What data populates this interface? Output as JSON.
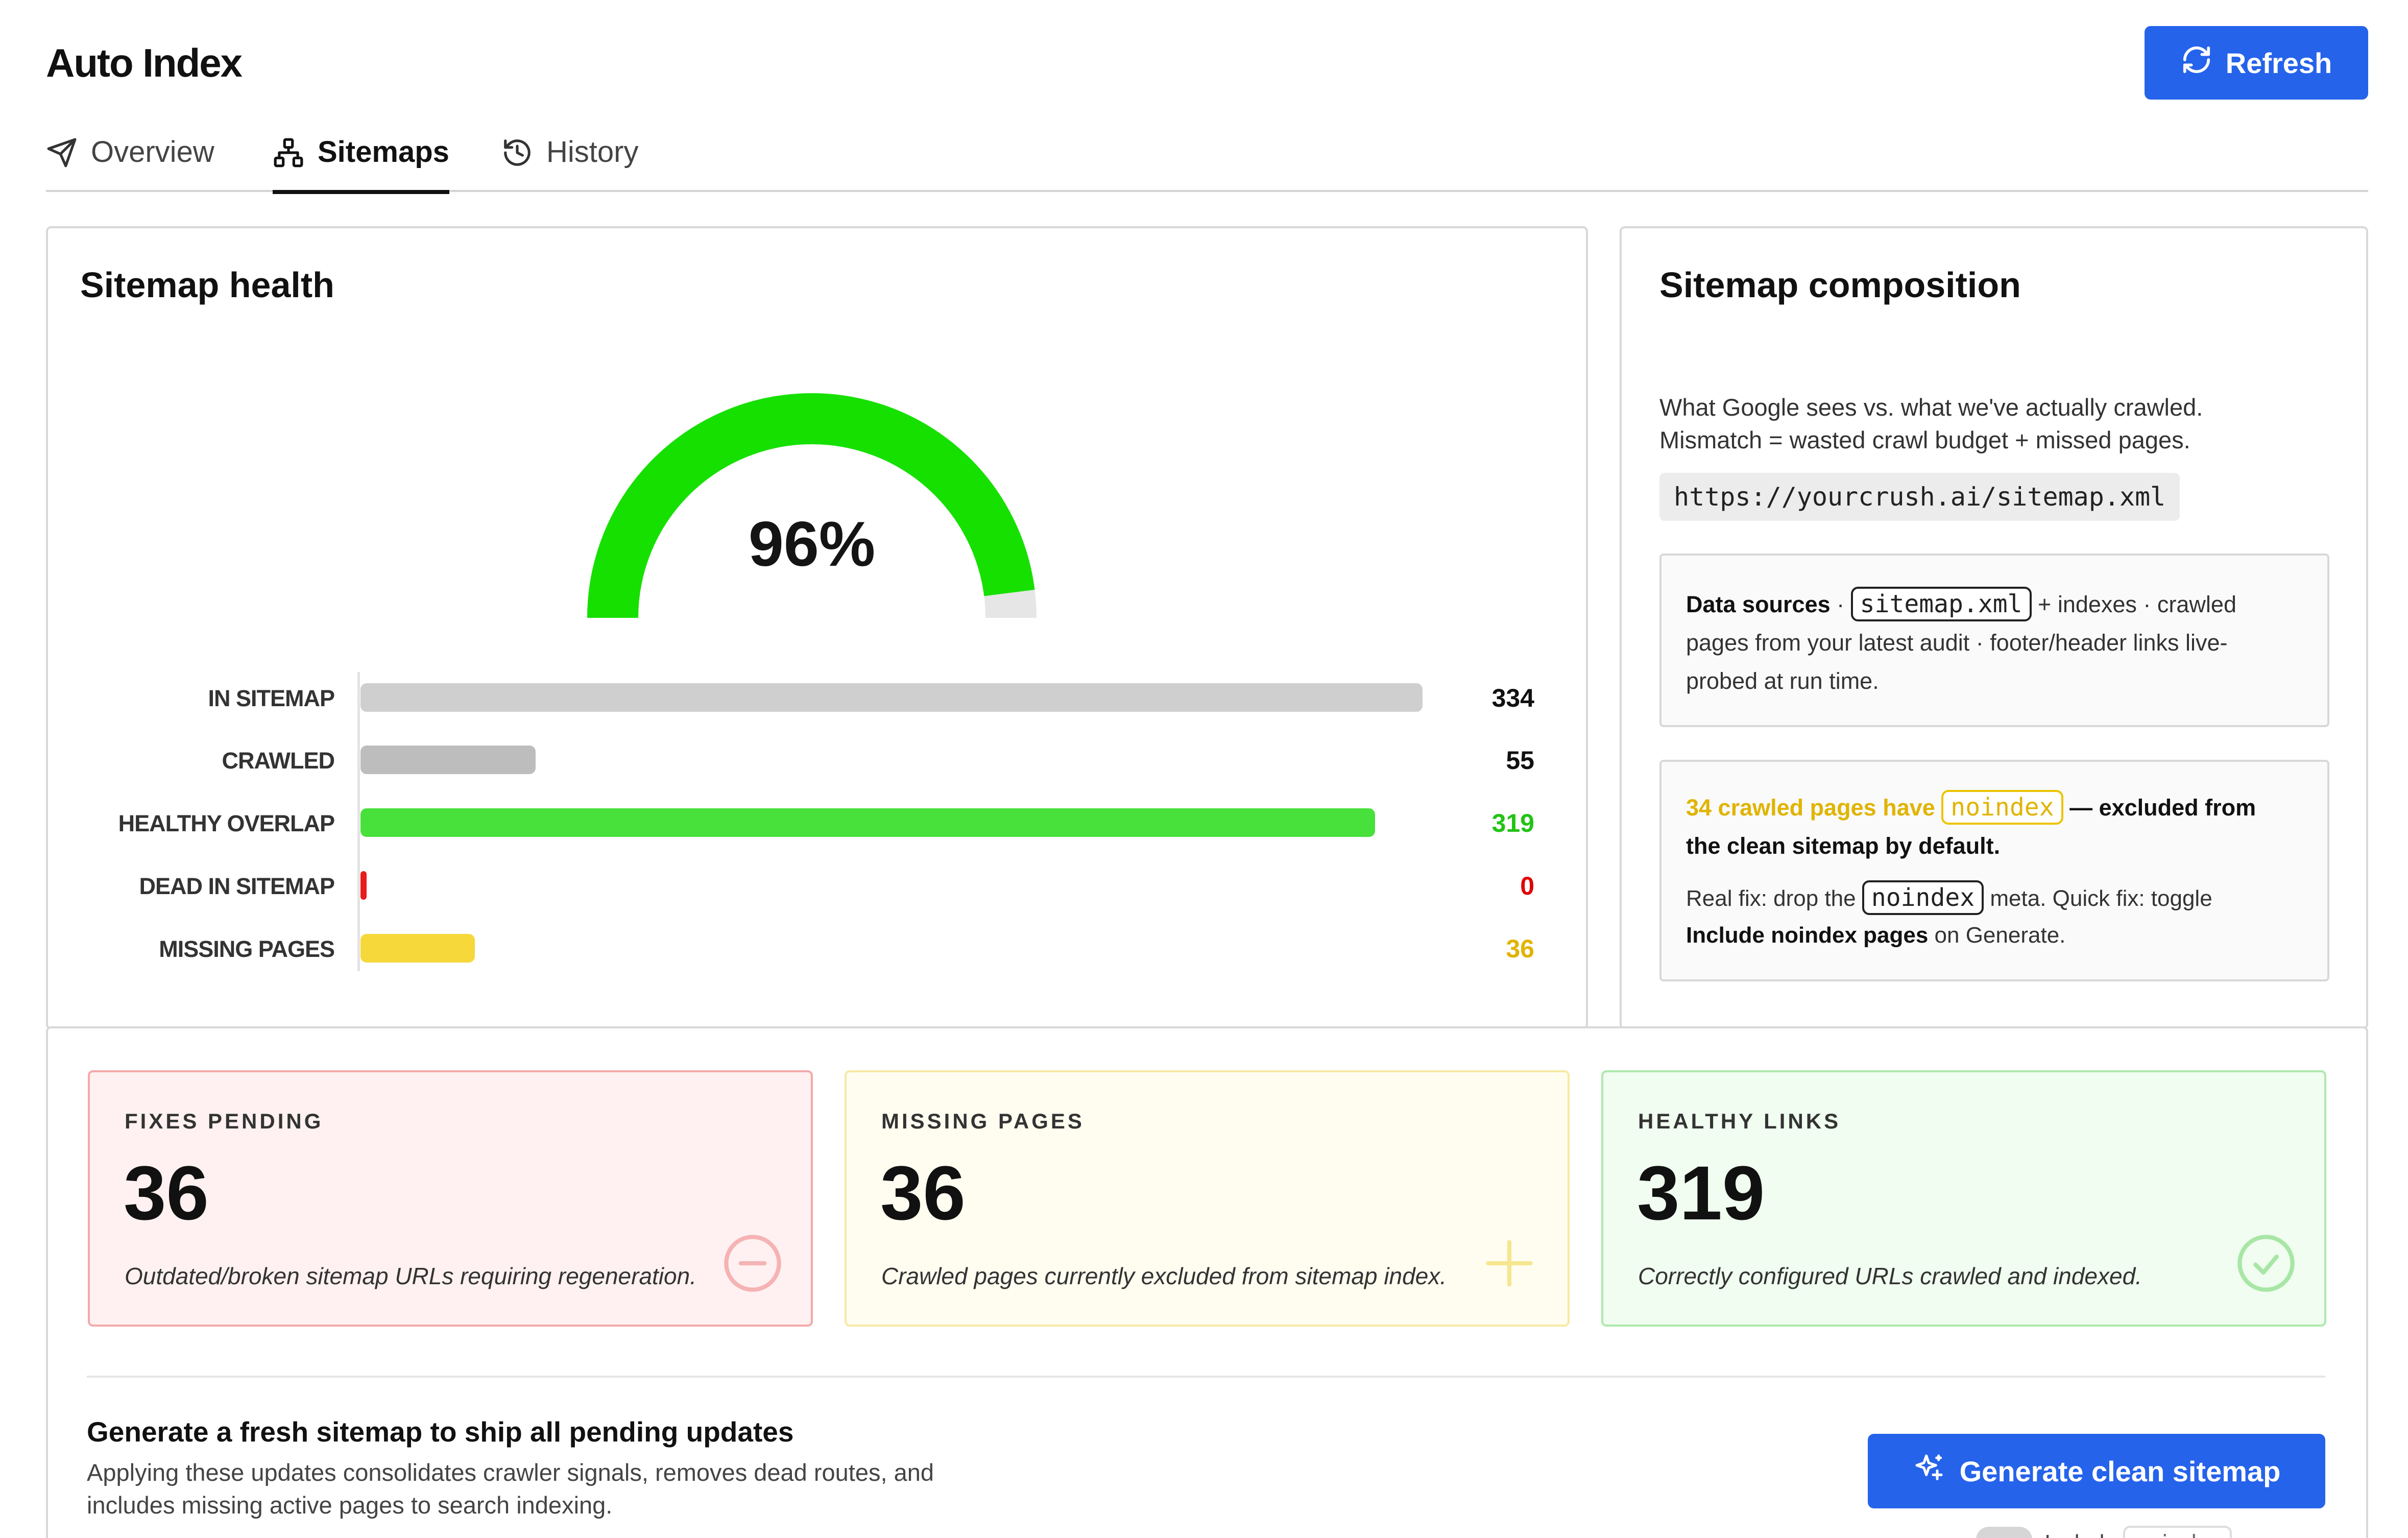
{
  "app": {
    "title": "Auto Index"
  },
  "header": {
    "refresh_label": "Refresh"
  },
  "tabs": [
    {
      "label": "Overview",
      "icon": "send-icon"
    },
    {
      "label": "Sitemaps",
      "icon": "sitemap-icon",
      "active": true
    },
    {
      "label": "History",
      "icon": "history-icon"
    }
  ],
  "health": {
    "title": "Sitemap health",
    "gauge": {
      "percent": 96,
      "label": "96%",
      "color": "#16e000",
      "track_color": "#e6e6e6"
    },
    "bars": [
      {
        "label": "IN SITEMAP",
        "value": 334,
        "display": "334",
        "color": "#cfcfcf",
        "value_color": "#111111"
      },
      {
        "label": "CRAWLED",
        "value": 55,
        "display": "55",
        "color": "#bdbdbd",
        "value_color": "#111111"
      },
      {
        "label": "HEALTHY OVERLAP",
        "value": 319,
        "display": "319",
        "color": "#48e03a",
        "value_color": "#22c315"
      },
      {
        "label": "DEAD IN SITEMAP",
        "value": 0,
        "display": "0",
        "color": "#e81c1c",
        "value_color": "#e10000"
      },
      {
        "label": "MISSING PAGES",
        "value": 36,
        "display": "36",
        "color": "#f6d83a",
        "value_color": "#e0b400"
      }
    ],
    "scale_max": 334
  },
  "composition": {
    "title": "Sitemap composition",
    "description_line1": "What Google sees vs. what we've actually crawled.",
    "description_line2": "Mismatch = wasted crawl budget + missed pages.",
    "sitemap_url": "https://yourcrush.ai/sitemap.xml",
    "sources": {
      "heading": "Data sources",
      "sep": " · ",
      "chip": "sitemap.xml",
      "rest_line1": " + indexes · crawled",
      "rest_line2": "pages from your latest audit · footer/header links live-",
      "rest_line3": "probed at run time."
    },
    "noindex": {
      "warn_lead": "34 crawled pages have",
      "chip": "noindex",
      "warn_rest": " — excluded from",
      "line2": "the clean sitemap by default.",
      "fix_lead": "Real fix: drop the",
      "fix_chip": "noindex",
      "fix_rest": " meta. Quick fix: toggle",
      "fix_bold": "Include noindex pages",
      "fix_end": " on Generate."
    }
  },
  "stats": [
    {
      "label": "FIXES PENDING",
      "value": "36",
      "description": "Outdated/broken sitemap URLs requiring regeneration.",
      "icon": "minus-circle-icon",
      "bg": "#fff1f1",
      "border": "#f3a9a9",
      "icon_color": "#f5b3b3"
    },
    {
      "label": "MISSING PAGES",
      "value": "36",
      "description": "Crawled pages currently excluded from sitemap index.",
      "icon": "plus-icon",
      "bg": "#fffdf0",
      "border": "#f7e9a6",
      "icon_color": "#f6e690"
    },
    {
      "label": "HEALTHY LINKS",
      "value": "319",
      "description": "Correctly configured URLs crawled and indexed.",
      "icon": "check-circle-icon",
      "bg": "#f0fdf0",
      "border": "#aee9ad",
      "icon_color": "#a8e6a6"
    }
  ],
  "generate": {
    "title": "Generate a fresh sitemap to ship all pending updates",
    "description_line1": "Applying these updates consolidates crawler signals, removes dead routes, and",
    "description_line2": "includes missing active pages to search indexing.",
    "button_label": "Generate clean sitemap",
    "toggle_label": "Include",
    "toggle_chip": "noindex"
  },
  "colors": {
    "accent": "#2563eb"
  }
}
